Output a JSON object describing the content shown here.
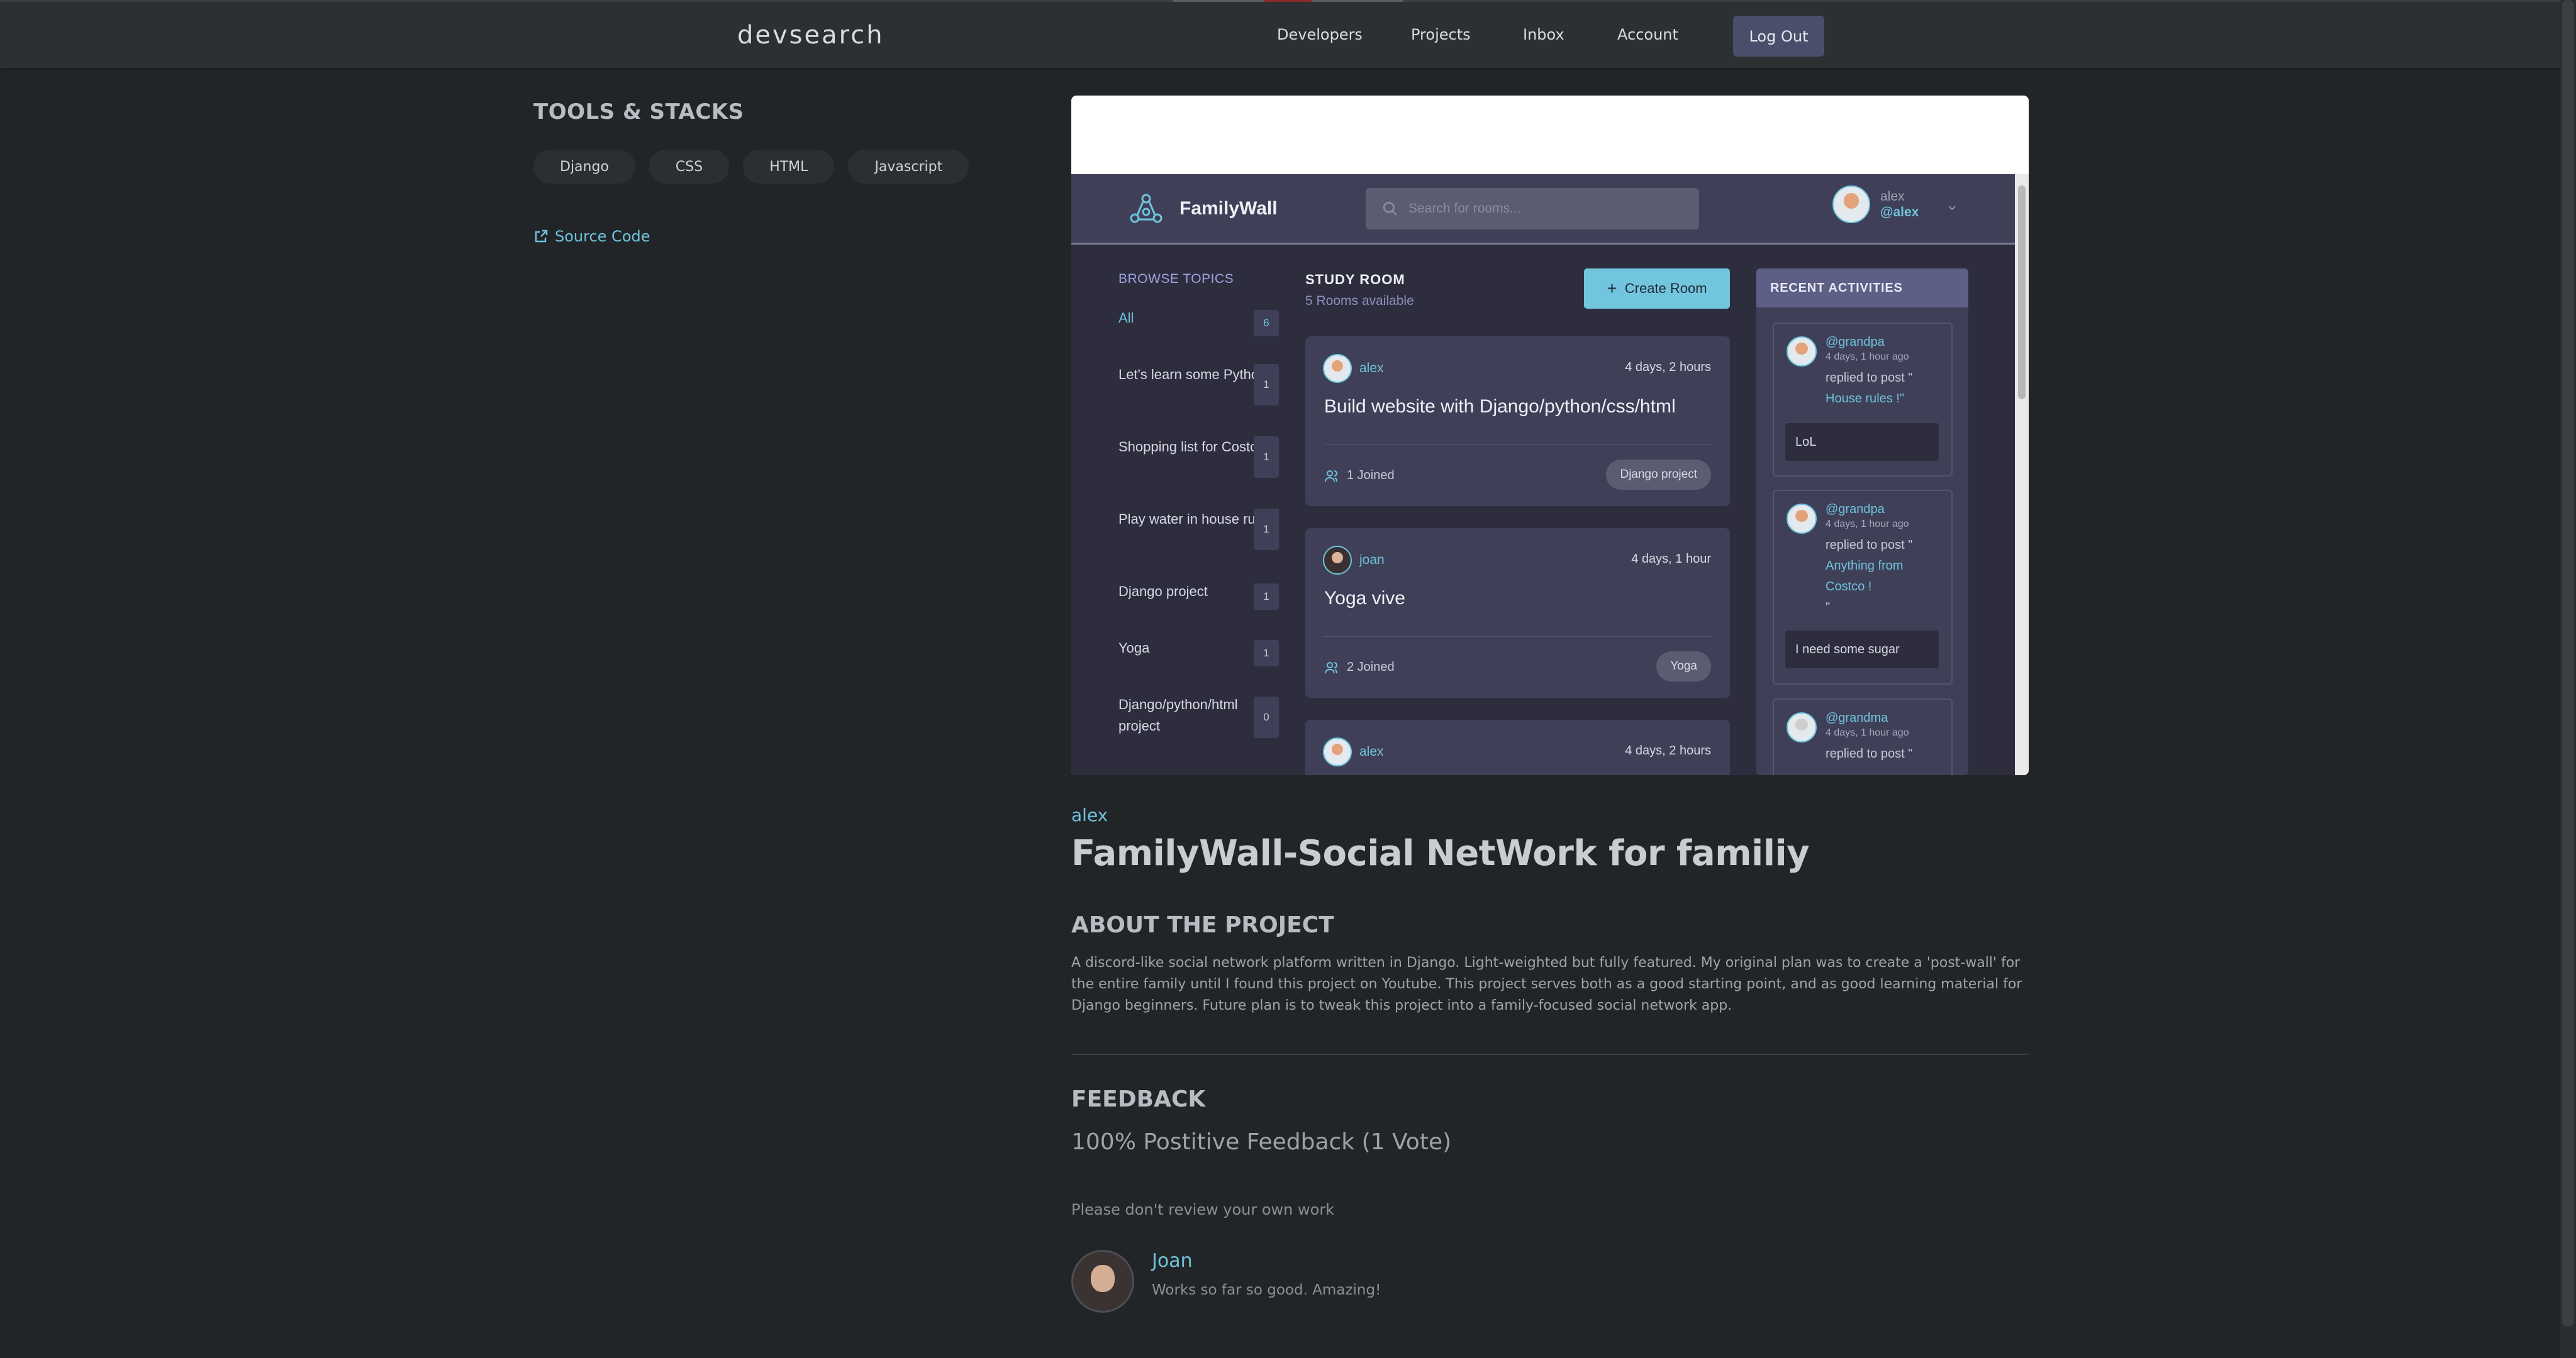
{
  "nav": {
    "logo": "devsearch",
    "links": [
      "Developers",
      "Projects",
      "Inbox",
      "Account"
    ],
    "logout": "Log Out"
  },
  "sidebar": {
    "tools_title": "TOOLS & STACKS",
    "tags": [
      "Django",
      "CSS",
      "HTML",
      "Javascript"
    ],
    "source_code": "Source Code"
  },
  "screenshot": {
    "brand": "FamilyWall",
    "search_placeholder": "Search for rooms...",
    "user_name": "alex",
    "user_handle": "@alex",
    "browse_title": "BROWSE TOPICS",
    "topics": [
      {
        "label": "All",
        "count": "6"
      },
      {
        "label": "Let's learn some Python",
        "count": "1"
      },
      {
        "label": "Shopping list for Costco",
        "count": "1"
      },
      {
        "label": "Play water in house rules",
        "count": "1"
      },
      {
        "label": "Django project",
        "count": "1"
      },
      {
        "label": "Yoga",
        "count": "1"
      },
      {
        "label": "Django/python/html project",
        "count": "0"
      }
    ],
    "study_room": "STUDY ROOM",
    "rooms_available": "5 Rooms available",
    "create_room": "Create Room",
    "rooms": [
      {
        "host": "alex",
        "time": "4 days, 2 hours",
        "title": "Build website with Django/python/css/html",
        "joined": "1 Joined",
        "tag": "Django project"
      },
      {
        "host": "joan",
        "time": "4 days, 1 hour",
        "title": "Yoga vive",
        "joined": "2 Joined",
        "tag": "Yoga"
      },
      {
        "host": "alex",
        "time": "4 days, 2 hours"
      }
    ],
    "recent_title": "RECENT ACTIVITIES",
    "activities": [
      {
        "user": "@grandpa",
        "ago": "4 days, 1 hour ago",
        "replied": "replied to post \"",
        "post": "House rules !\"",
        "message": "LoL"
      },
      {
        "user": "@grandpa",
        "ago": "4 days, 1 hour ago",
        "replied": "replied to post \"",
        "post": "Anything from Costco !",
        "tail": "\"",
        "message": "I need some sugar"
      },
      {
        "user": "@grandma",
        "ago": "4 days, 1 hour ago",
        "replied": "replied to post \""
      }
    ]
  },
  "project": {
    "owner": "alex",
    "title": "FamilyWall-Social NetWork for familiy",
    "about_heading": "ABOUT THE PROJECT",
    "description": "A discord-like social network platform written in Django. Light-weighted but fully featured. My original plan was to create a 'post-wall' for the entire family until I found this project on Youtube. This project serves both as a good starting point, and as good learning material for Django beginners. Future plan is to tweak this project into a family-focused social network app.",
    "feedback_heading": "FEEDBACK",
    "feedback_score": "100% Postitive Feedback (1 Vote)",
    "feedback_note": "Please don't review your own work",
    "review": {
      "name": "Joan",
      "text": "Works so far so good. Amazing!"
    }
  },
  "colors": {
    "accent": "#6fc3dc",
    "background": "#222528",
    "app_bg": "#2d2d3e",
    "card": "#3f4058"
  }
}
